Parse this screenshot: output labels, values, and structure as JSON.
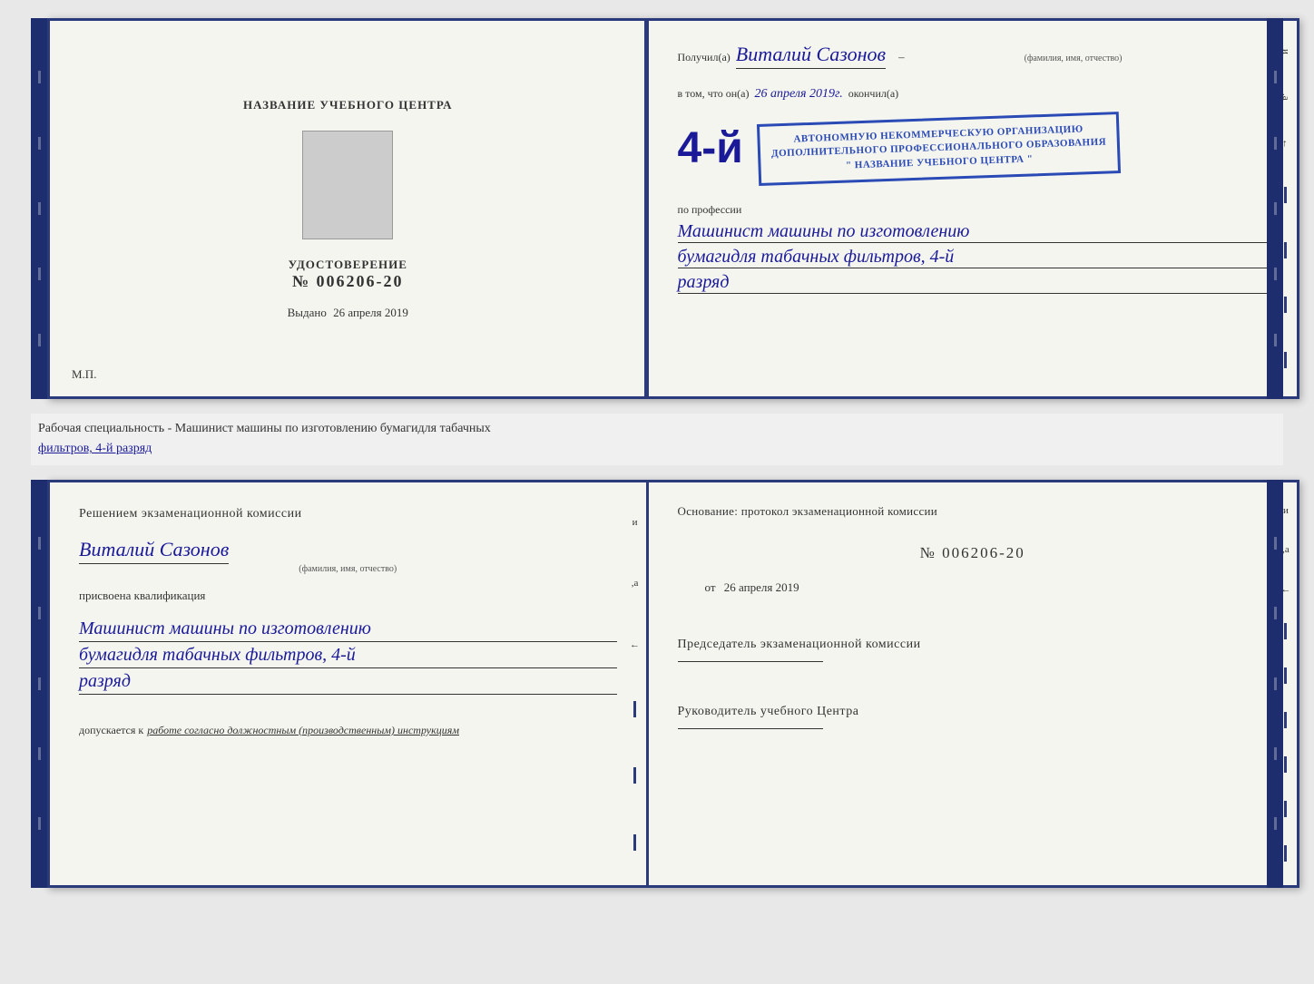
{
  "page": {
    "background": "#e8e8e8"
  },
  "cert_book": {
    "left_page": {
      "center_title": "НАЗВАНИЕ УЧЕБНОГО ЦЕНТРА",
      "cert_title": "УДОСТОВЕРЕНИЕ",
      "cert_number": "№ 006206-20",
      "issued_label": "Выдано",
      "issued_date": "26 апреля 2019",
      "mp_label": "М.П."
    },
    "right_page": {
      "received_prefix": "Получил(а)",
      "recipient_name": "Виталий Сазонов",
      "recipient_label": "(фамилия, имя, отчество)",
      "in_that_prefix": "в том, что он(а)",
      "date_handwritten": "26 апреля 2019г.",
      "finished_label": "окончил(а)",
      "large_number": "4-й",
      "stamp_line1": "АВТОНОМНУЮ НЕКОММЕРЧЕСКУЮ ОРГАНИЗАЦИЮ",
      "stamp_line2": "ДОПОЛНИТЕЛЬНОГО ПРОФЕССИОНАЛЬНОГО ОБРАЗОВАНИЯ",
      "stamp_line3": "\" НАЗВАНИЕ УЧЕБНОГО ЦЕНТРА \"",
      "profession_prefix": "по профессии",
      "profession_line1": "Машинист машины по изготовлению",
      "profession_line2": "бумагидля табачных фильтров, 4-й",
      "profession_line3": "разряд"
    }
  },
  "info_strip": {
    "text_normal": "Рабочая специальность - Машинист машины по изготовлению бумагидля табачных",
    "text_underline": "фильтров, 4-й разряд"
  },
  "qual_book": {
    "left_page": {
      "decision_text": "Решением экзаменационной комиссии",
      "person_name": "Виталий Сазонов",
      "person_label": "(фамилия, имя, отчество)",
      "assigned_text": "присвоена квалификация",
      "qual_line1": "Машинист машины по изготовлению",
      "qual_line2": "бумагидля табачных фильтров, 4-й",
      "qual_line3": "разряд",
      "admission_prefix": "допускается к",
      "admission_text": "работе согласно должностным (производственным) инструкциям"
    },
    "right_page": {
      "basis_text": "Основание: протокол экзаменационной комиссии",
      "protocol_number": "№ 006206-20",
      "date_prefix": "от",
      "date_value": "26 апреля 2019",
      "chairman_title": "Председатель экзаменационной комиссии",
      "director_title": "Руководитель учебного Центра"
    }
  }
}
